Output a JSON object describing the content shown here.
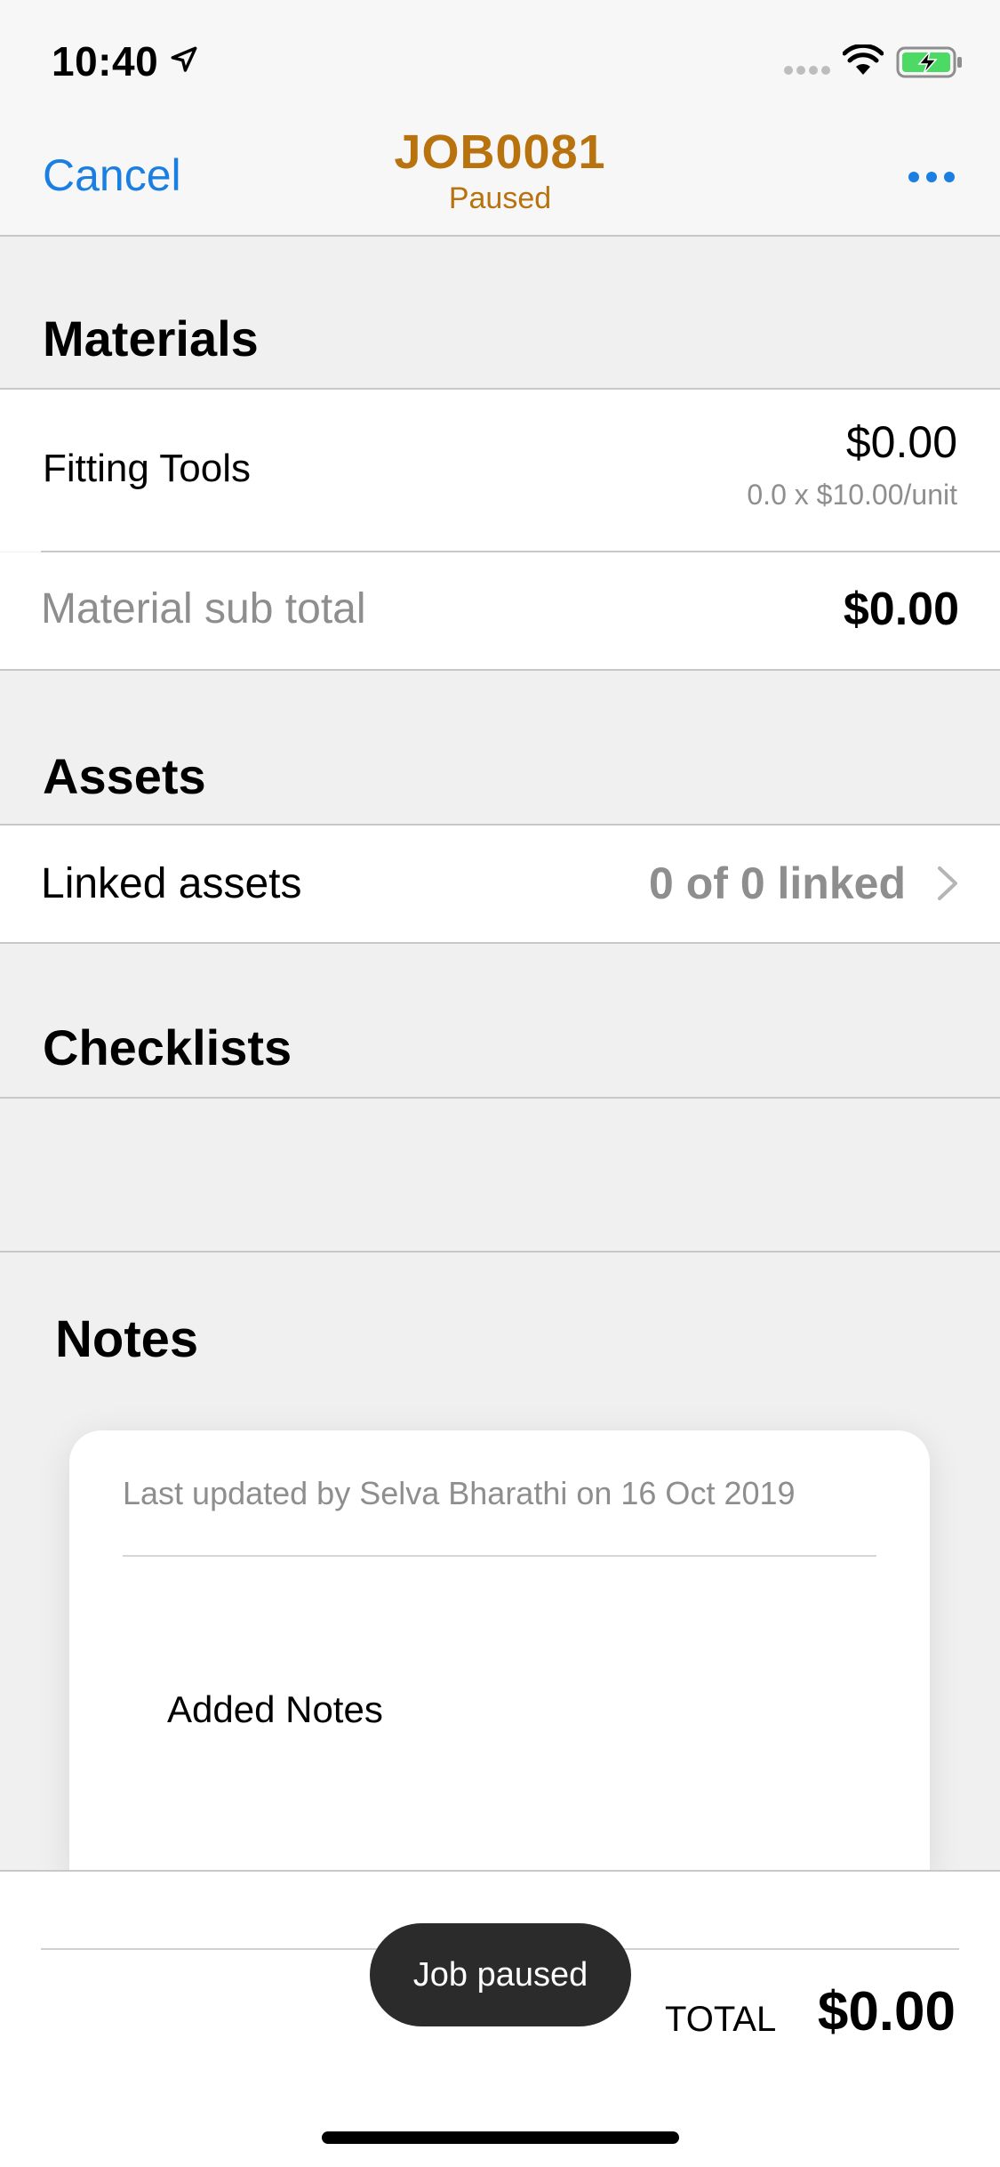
{
  "status_bar": {
    "time": "10:40",
    "icons": [
      "location-arrow-icon",
      "cellular-signal-icon",
      "wifi-icon",
      "battery-charging-icon"
    ],
    "battery_color": "#4cd964"
  },
  "nav": {
    "cancel_label": "Cancel",
    "title": "JOB0081",
    "subtitle": "Paused",
    "more_icon": "ellipsis-icon",
    "title_color": "#b8720e",
    "accent_color": "#1a7fe0"
  },
  "materials": {
    "title": "Materials",
    "items": [
      {
        "name": "Fitting Tools",
        "price": "$0.00",
        "detail": "0.0 x $10.00/unit"
      }
    ],
    "subtotal_label": "Material sub total",
    "subtotal_value": "$0.00"
  },
  "assets": {
    "title": "Assets",
    "linked_label": "Linked assets",
    "linked_value": "0 of 0 linked"
  },
  "checklists": {
    "title": "Checklists"
  },
  "notes": {
    "title": "Notes",
    "meta": "Last updated by Selva Bharathi on 16 Oct 2019",
    "body": "Added Notes"
  },
  "footer": {
    "total_label": "TOTAL",
    "total_value": "$0.00"
  },
  "toast": {
    "message": "Job paused"
  }
}
